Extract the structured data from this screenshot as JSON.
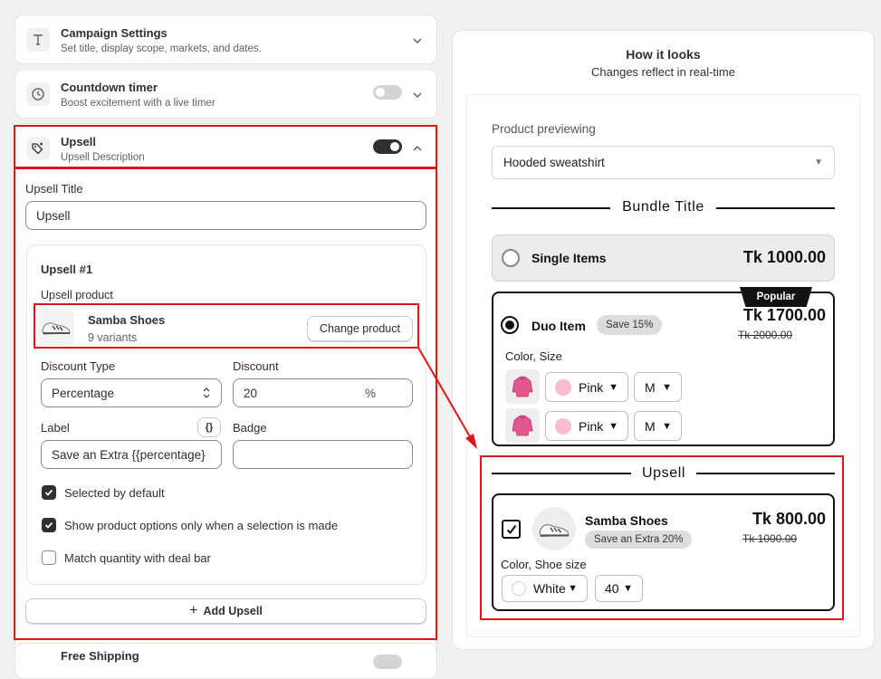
{
  "sections": {
    "campaign": {
      "title": "Campaign Settings",
      "desc": "Set title, display scope, markets, and dates."
    },
    "countdown": {
      "title": "Countdown timer",
      "desc": "Boost excitement with a live timer",
      "enabled": false
    },
    "upsell": {
      "title": "Upsell",
      "desc": "Upsell Description",
      "enabled": true
    },
    "free_shipping": {
      "title": "Free Shipping"
    }
  },
  "upsell_form": {
    "title_label": "Upsell Title",
    "title_value": "Upsell",
    "item": {
      "heading": "Upsell #1",
      "product_label": "Upsell product",
      "product_name": "Samba Shoes",
      "product_variants": "9 variants",
      "change_button": "Change product",
      "discount_type_label": "Discount Type",
      "discount_type_value": "Percentage",
      "discount_label": "Discount",
      "discount_value": "20",
      "discount_unit": "%",
      "label_label": "Label",
      "label_value": "Save an Extra {{percentage}",
      "variable_button": "{}",
      "badge_label": "Badge",
      "badge_value": "",
      "checkboxes": [
        {
          "label": "Selected by default",
          "checked": true
        },
        {
          "label": "Show product options only when a selection is made",
          "checked": true
        },
        {
          "label": "Match quantity with deal bar",
          "checked": false
        }
      ]
    },
    "add_button": "Add Upsell"
  },
  "preview": {
    "title": "How it looks",
    "subtitle": "Changes reflect in real-time",
    "product_label": "Product previewing",
    "product_value": "Hooded sweatshirt",
    "bundle_title": "Bundle Title",
    "single": {
      "label": "Single Items",
      "price": "Tk 1000.00"
    },
    "duo": {
      "badge_popular": "Popular",
      "label": "Duo Item",
      "save_badge": "Save 15%",
      "price": "Tk 1700.00",
      "compare_price": "Tk 2000.00",
      "options_label": "Color, Size",
      "rows": [
        {
          "color": "Pink",
          "size": "M"
        },
        {
          "color": "Pink",
          "size": "M"
        }
      ]
    },
    "upsell": {
      "heading": "Upsell",
      "name": "Samba Shoes",
      "badge": "Save an Extra 20%",
      "price": "Tk 800.00",
      "compare_price": "Tk 1000.00",
      "options_label": "Color, Shoe size",
      "color": "White",
      "size": "40"
    }
  },
  "colors": {
    "accent_dark": "#303030",
    "highlight_red": "#e01616",
    "swatch_pink": "#f8bcca",
    "hoodie_pink": "#e2578d"
  }
}
